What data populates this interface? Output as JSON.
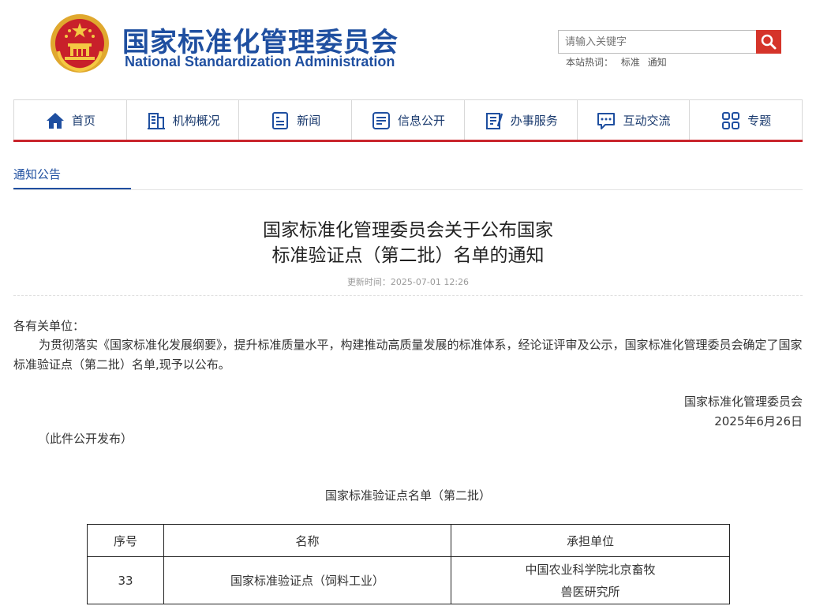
{
  "header": {
    "title_cn": "国家标准化管理委员会",
    "title_en": "National Standardization Administration",
    "search_placeholder": "请输入关键字",
    "hot_label": "本站热词：",
    "hot_words": [
      "标准",
      "通知"
    ]
  },
  "nav": {
    "items": [
      {
        "label": "首页",
        "icon": "home-icon"
      },
      {
        "label": "机构概况",
        "icon": "building-icon"
      },
      {
        "label": "新闻",
        "icon": "news-icon"
      },
      {
        "label": "信息公开",
        "icon": "info-icon"
      },
      {
        "label": "办事服务",
        "icon": "service-icon"
      },
      {
        "label": "互动交流",
        "icon": "chat-icon"
      },
      {
        "label": "专题",
        "icon": "grid-icon"
      }
    ]
  },
  "section": {
    "tab_label": "通知公告"
  },
  "article": {
    "title_line1": "国家标准化管理委员会关于公布国家",
    "title_line2": "标准验证点（第二批）名单的通知",
    "update_time": "更新时间：2025-07-01 12:26",
    "salutation": "各有关单位：",
    "paragraph": "为贯彻落实《国家标准化发展纲要》，提升标准质量水平，构建推动高质量发展的标准体系，经论证评审及公示，国家标准化管理委员会确定了国家标准验证点（第二批）名单,现予以公布。",
    "signer": "国家标准化管理委员会",
    "date": "2025年6月26日",
    "note": "（此件公开发布）"
  },
  "table": {
    "title": "国家标准验证点名单（第二批）",
    "headers": [
      "序号",
      "名称",
      "承担单位"
    ],
    "rows": [
      {
        "no": "33",
        "name": "国家标准验证点（饲料工业）",
        "unit_line1": "中国农业科学院北京畜牧",
        "unit_line2": "兽医研究所"
      }
    ]
  },
  "colors": {
    "brand_blue": "#1f4fa0",
    "accent_red": "#c9252c",
    "search_red": "#d5342a"
  }
}
